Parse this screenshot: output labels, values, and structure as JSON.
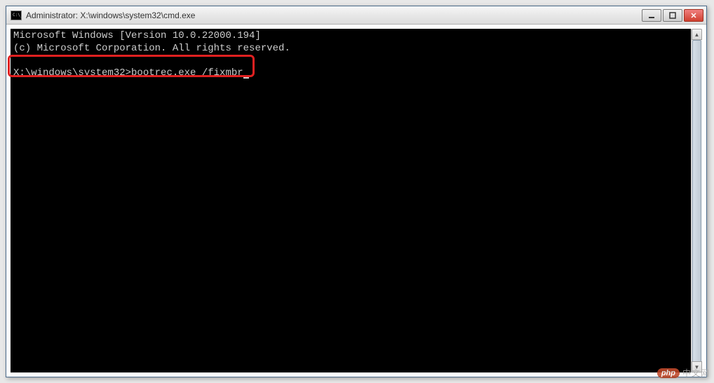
{
  "window": {
    "title": "Administrator: X:\\windows\\system32\\cmd.exe"
  },
  "terminal": {
    "line1": "Microsoft Windows [Version 10.0.22000.194]",
    "line2": "(c) Microsoft Corporation. All rights reserved.",
    "prompt": "X:\\windows\\system32>",
    "command": "bootrec.exe /fixmbr"
  },
  "watermark": {
    "badge": "php",
    "text": "中文网"
  },
  "colors": {
    "highlight_border": "#e02020",
    "terminal_bg": "#000000",
    "terminal_fg": "#cccccc"
  }
}
